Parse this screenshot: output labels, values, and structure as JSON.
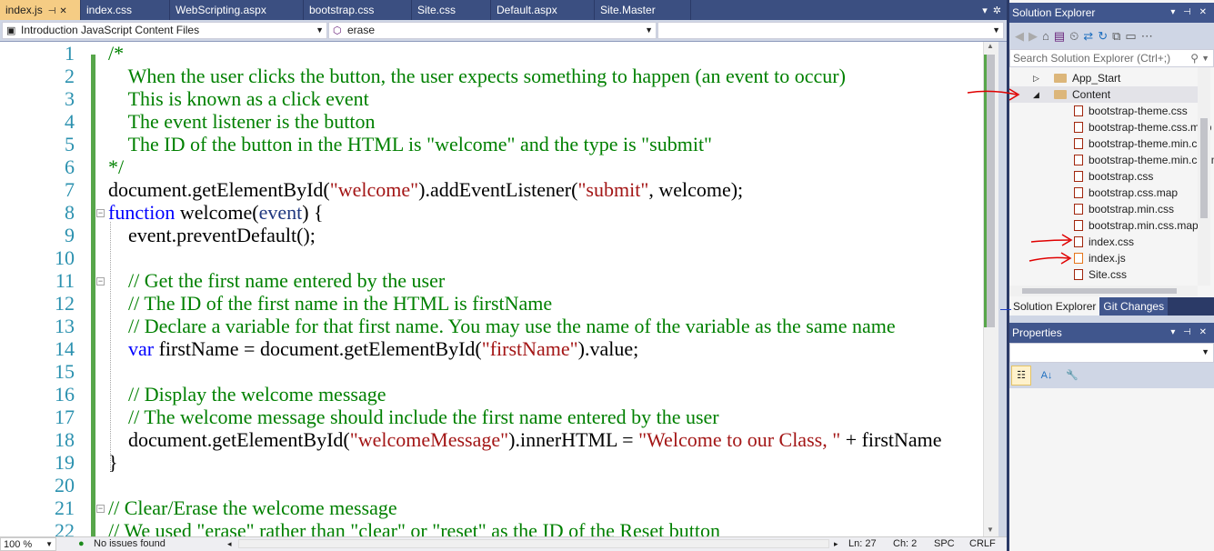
{
  "tabs": [
    {
      "label": "index.js",
      "active": true
    },
    {
      "label": "index.css"
    },
    {
      "label": "WebScripting.aspx"
    },
    {
      "label": "bootstrap.css"
    },
    {
      "label": "Site.css"
    },
    {
      "label": "Default.aspx"
    },
    {
      "label": "Site.Master"
    }
  ],
  "navbar": {
    "project": "Introduction JavaScript Content Files",
    "member": "erase",
    "third": ""
  },
  "code": {
    "line_numbers": [
      "1",
      "2",
      "3",
      "4",
      "5",
      "6",
      "7",
      "8",
      "9",
      "10",
      "11",
      "12",
      "13",
      "14",
      "15",
      "16",
      "17",
      "18",
      "19",
      "20",
      "21",
      "22"
    ],
    "lines": [
      "/*",
      "    When the user clicks the button, the user expects something to happen (an event to occur)",
      "    This is known as a click event",
      "    The event listener is the button",
      "    The ID of the button in the HTML is \"welcome\" and the type is \"submit\"",
      "*/",
      "document.getElementById(\"welcome\").addEventListener(\"submit\", welcome);",
      "function welcome(event) {",
      "    event.preventDefault();",
      "",
      "    // Get the first name entered by the user",
      "    // The ID of the first name in the HTML is firstName",
      "    // Declare a variable for that first name. You may use the name of the variable as the same name",
      "    var firstName = document.getElementById(\"firstName\").value;",
      "",
      "    // Display the welcome message",
      "    // The welcome message should include the first name entered by the user",
      "    document.getElementById(\"welcomeMessage\").innerHTML = \"Welcome to our Class, \" + firstName",
      "}",
      "",
      "// Clear/Erase the welcome message",
      "// We used \"erase\" rather than \"clear\" or \"reset\" as the ID of the Reset button"
    ],
    "tokens": {
      "l7a": "document.getElementById(",
      "l7b": "\"welcome\"",
      "l7c": ").addEventListener(",
      "l7d": "\"submit\"",
      "l7e": ", welcome);",
      "l8a": "function",
      "l8b": " welcome(",
      "l8c": "event",
      "l8d": ") {",
      "l14a": "    ",
      "l14b": "var",
      "l14c": " firstName = document.getElementById(",
      "l14d": "\"firstName\"",
      "l14e": ").value;",
      "l18a": "    document.getElementById(",
      "l18b": "\"welcomeMessage\"",
      "l18c": ").innerHTML = ",
      "l18d": "\"Welcome to our Class, \"",
      "l18e": " + firstName"
    }
  },
  "status": {
    "zoom": "100 %",
    "issues": "No issues found",
    "line": "Ln: 27",
    "col": "Ch: 2",
    "spc": "SPC",
    "crlf": "CRLF"
  },
  "solution_explorer": {
    "title": "Solution Explorer",
    "search_placeholder": "Search Solution Explorer (Ctrl+;)",
    "tree": [
      {
        "label": "App_Start",
        "type": "folder",
        "expanded": false
      },
      {
        "label": "Content",
        "type": "folder",
        "expanded": true,
        "selected": true
      },
      {
        "label": "bootstrap-theme.css",
        "type": "css"
      },
      {
        "label": "bootstrap-theme.css.map",
        "type": "css"
      },
      {
        "label": "bootstrap-theme.min.css",
        "type": "css"
      },
      {
        "label": "bootstrap-theme.min.css.map",
        "type": "css"
      },
      {
        "label": "bootstrap.css",
        "type": "css"
      },
      {
        "label": "bootstrap.css.map",
        "type": "css"
      },
      {
        "label": "bootstrap.min.css",
        "type": "css"
      },
      {
        "label": "bootstrap.min.css.map",
        "type": "css"
      },
      {
        "label": "index.css",
        "type": "css"
      },
      {
        "label": "index.js",
        "type": "js"
      },
      {
        "label": "Site.css",
        "type": "css"
      }
    ],
    "tabs": [
      "Solution Explorer",
      "Git Changes"
    ]
  },
  "properties": {
    "title": "Properties"
  },
  "colors": {
    "comment": "#008000",
    "string": "#a31515",
    "keyword": "#0000ff",
    "line_number": "#2b91af",
    "active_tab": "#f5cc84",
    "panel_title": "#40568d",
    "annotation": "#e00000"
  }
}
